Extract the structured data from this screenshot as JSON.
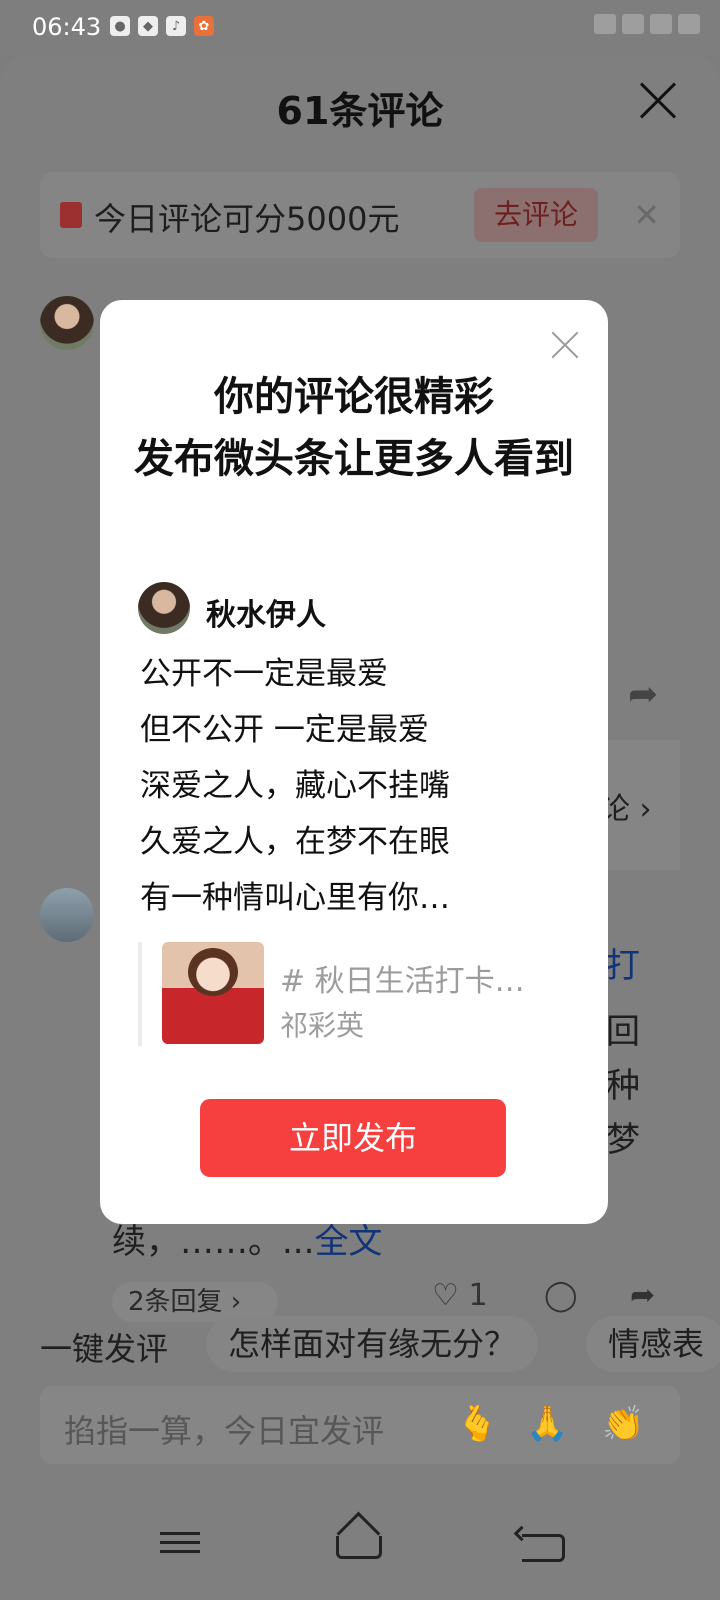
{
  "status_bar": {
    "time": "06:43",
    "icons": [
      "wechat-icon",
      "app-icon",
      "tiktok-icon",
      "orange-app-icon"
    ]
  },
  "sheet": {
    "title": "61条评论",
    "banner": {
      "text": "今日评论可分5000元",
      "button": "去评论"
    },
    "background_comment": {
      "fragments": [
        "打",
        "回",
        "种",
        "梦"
      ],
      "tail": "续，……。...",
      "full_text_link": "全文",
      "side_fragment": "论 ›",
      "replies": "2条回复 ›",
      "like_count": "1"
    },
    "chips": {
      "label": "一键发评",
      "items": [
        "怎样面对有缘无分？",
        "情感表"
      ]
    },
    "input": {
      "placeholder": "掐指一算，今日宜发评",
      "emojis": [
        "🫰",
        "🙏",
        "👏"
      ]
    }
  },
  "modal": {
    "title_lines": [
      "你的评论很精彩",
      "发布微头条让更多人看到"
    ],
    "author": "秋水伊人",
    "body_lines": [
      "公开不一定是最爱",
      "但不公开 一定是最爱",
      "深爱之人，藏心不挂嘴",
      "久爱之人，在梦不在眼",
      "有一种情叫心里有你…"
    ],
    "quote": {
      "title": "# 秋日生活打卡…",
      "author": "祁彩英"
    },
    "publish_button": "立即发布"
  },
  "colors": {
    "publish_red": "#f6403f",
    "overlay_gray": "#7f7f7f",
    "link_blue": "#10347a"
  }
}
